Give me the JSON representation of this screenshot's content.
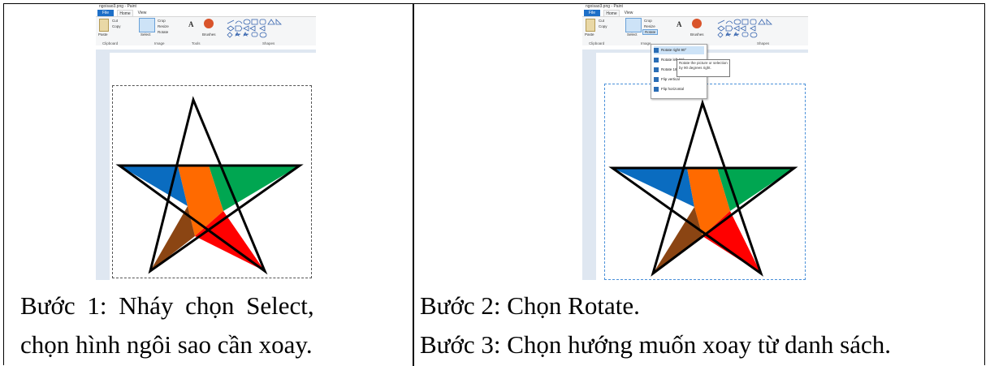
{
  "left": {
    "window_title": "ngoisao3.png - Paint",
    "tabs": [
      "File",
      "Home",
      "View"
    ],
    "ribbon": {
      "cut": "Cut",
      "copy": "Copy",
      "paste": "Paste",
      "select": "Select",
      "crop": "Crop",
      "resize": "Resize",
      "rotate": "Rotate",
      "brushes": "Brushes",
      "groups": [
        "Clipboard",
        "Image",
        "Tools",
        "Shapes"
      ]
    },
    "caption_line1": "Bước 1: Nháy chọn Select,",
    "caption_line2": "chọn hình ngôi sao cần xoay."
  },
  "right": {
    "window_title": "ngoisao3.png - Paint",
    "tabs": [
      "File",
      "Home",
      "View"
    ],
    "ribbon": {
      "cut": "Cut",
      "copy": "Copy",
      "paste": "Paste",
      "select": "Select",
      "crop": "Crop",
      "resize": "Resize",
      "rotate": "Rotate",
      "brushes": "Brushes",
      "groups": [
        "Clipboard",
        "Image",
        "Shapes"
      ]
    },
    "rotate_menu": [
      "Rotate right 90°",
      "Rotate left 90°",
      "Rotate 180°",
      "Flip vertical",
      "Flip horizontal"
    ],
    "tooltip": "Rotate the picture or selection by 90 degrees right.",
    "caption_line1": "Bước 2: Chọn Rotate.",
    "caption_line2": "Bước 3: Chọn hướng muốn xoay từ danh sách."
  },
  "colors": {
    "star_top": "#ffffff",
    "star_left": "#0a6cc0",
    "star_right": "#00a651",
    "star_center": "#ff6a00",
    "star_bottom_left": "#8b4513",
    "star_bottom_right": "#ff0000",
    "paint_file_tab": "#1e6fc7"
  }
}
